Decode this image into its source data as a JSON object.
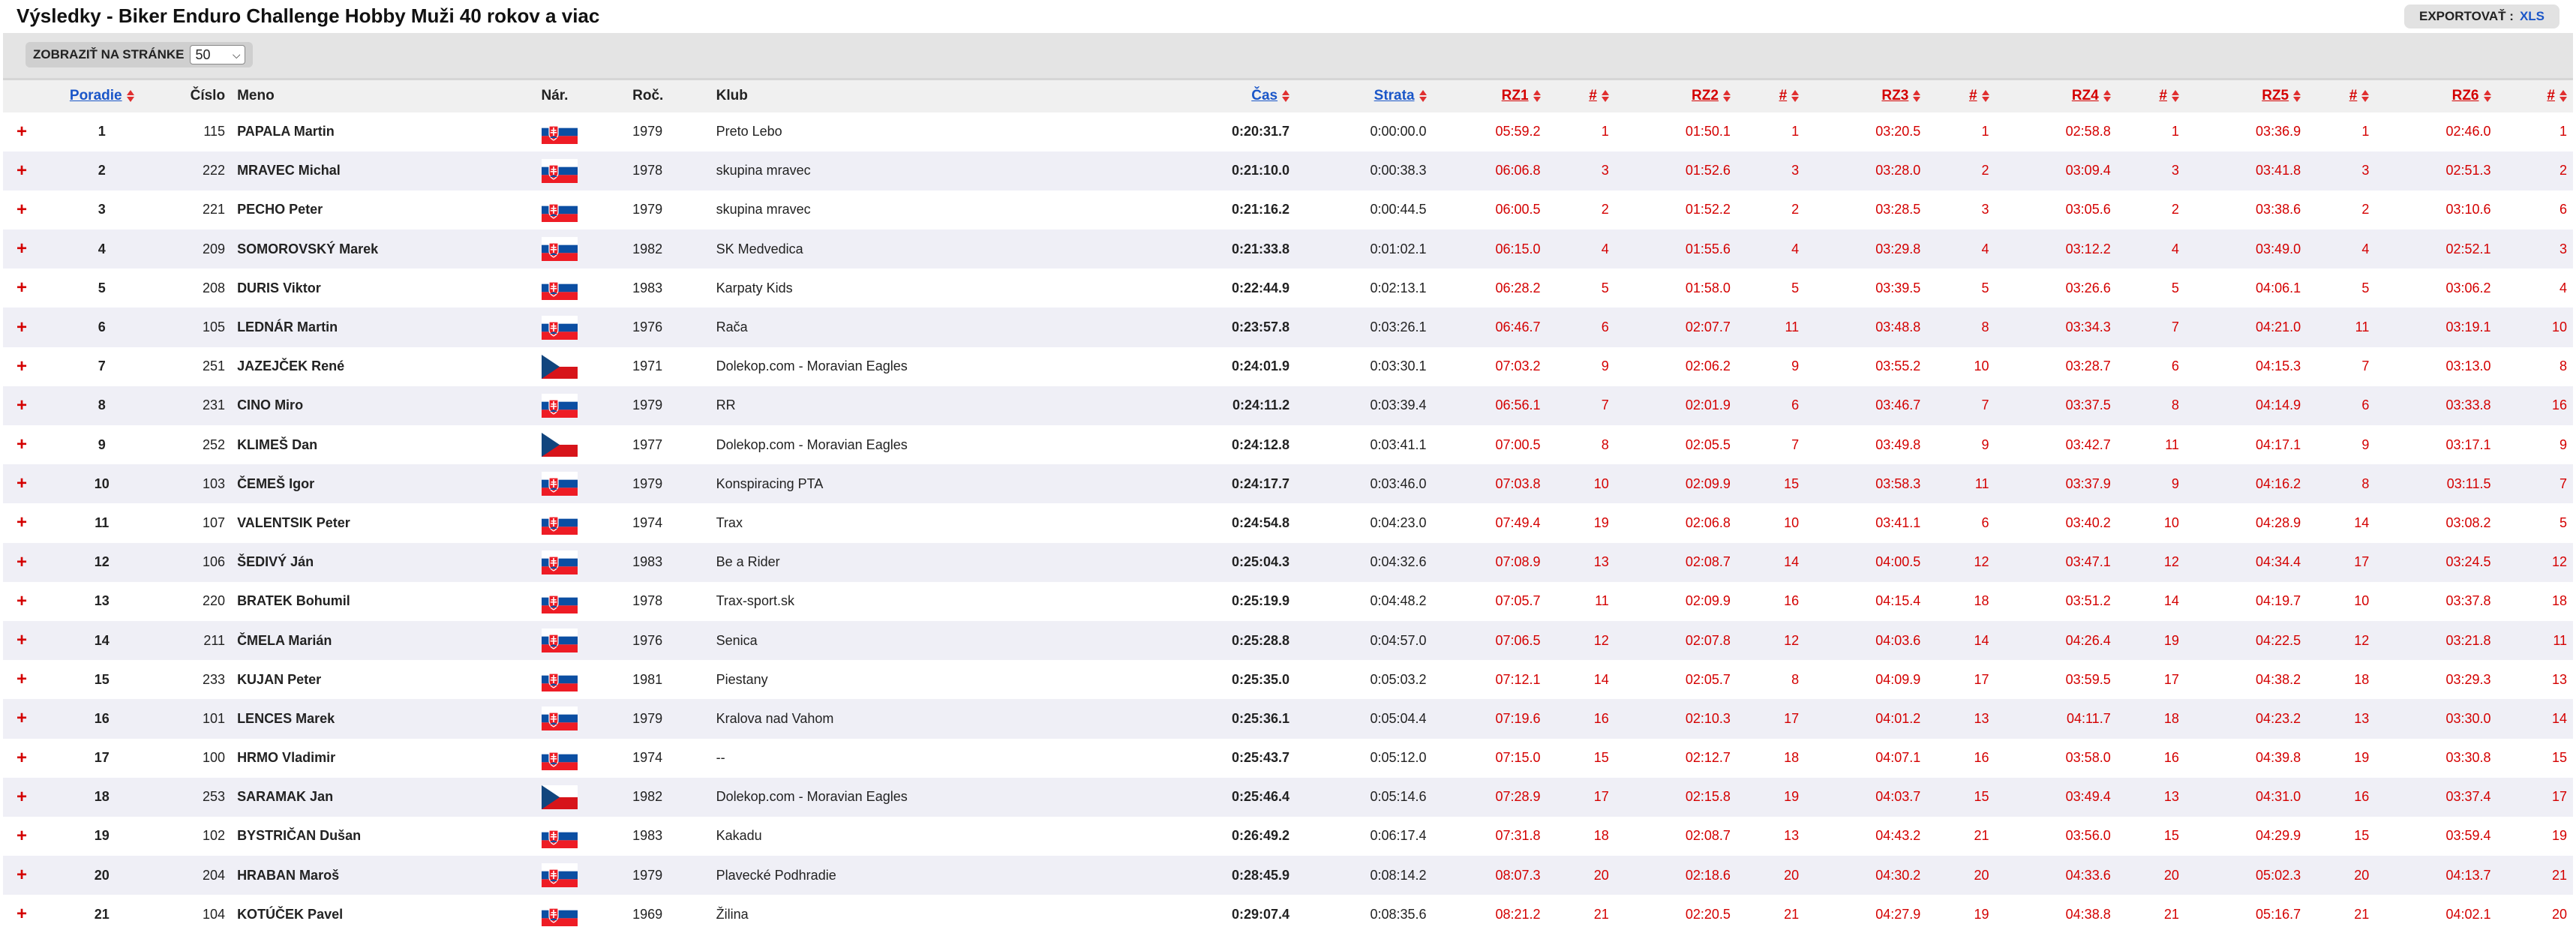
{
  "title": "Výsledky - Biker Enduro Challenge Hobby Muži 40 rokov a viac",
  "export": {
    "label": "EXPORTOVAŤ :",
    "xls": "XLS"
  },
  "perpage": {
    "label": "ZOBRAZIŤ NA STRÁNKE",
    "value": "50"
  },
  "columns": {
    "poradie": "Poradie",
    "cislo": "Číslo",
    "meno": "Meno",
    "nar": "Nár.",
    "roc": "Roč.",
    "klub": "Klub",
    "cas": "Čas",
    "strata": "Strata",
    "rz1": "RZ1",
    "rz2": "RZ2",
    "rz3": "RZ3",
    "rz4": "RZ4",
    "rz5": "RZ5",
    "rz6": "RZ6",
    "hash": "#"
  },
  "colors": {
    "accent_link": "#1a56c8",
    "accent_red": "#d40000",
    "row_alt": "#efeff6"
  },
  "rows": [
    {
      "pos": "1",
      "num": "115",
      "name": "PAPALA Martin",
      "nat": "SVK",
      "year": "1979",
      "club": "Preto Lebo",
      "time": "0:20:31.7",
      "loss": "0:00:00.0",
      "rz": [
        [
          "05:59.2",
          "1"
        ],
        [
          "01:50.1",
          "1"
        ],
        [
          "03:20.5",
          "1"
        ],
        [
          "02:58.8",
          "1"
        ],
        [
          "03:36.9",
          "1"
        ],
        [
          "02:46.0",
          "1"
        ]
      ]
    },
    {
      "pos": "2",
      "num": "222",
      "name": "MRAVEC Michal",
      "nat": "SVK",
      "year": "1978",
      "club": "skupina mravec",
      "time": "0:21:10.0",
      "loss": "0:00:38.3",
      "rz": [
        [
          "06:06.8",
          "3"
        ],
        [
          "01:52.6",
          "3"
        ],
        [
          "03:28.0",
          "2"
        ],
        [
          "03:09.4",
          "3"
        ],
        [
          "03:41.8",
          "3"
        ],
        [
          "02:51.3",
          "2"
        ]
      ]
    },
    {
      "pos": "3",
      "num": "221",
      "name": "PECHO Peter",
      "nat": "SVK",
      "year": "1979",
      "club": "skupina mravec",
      "time": "0:21:16.2",
      "loss": "0:00:44.5",
      "rz": [
        [
          "06:00.5",
          "2"
        ],
        [
          "01:52.2",
          "2"
        ],
        [
          "03:28.5",
          "3"
        ],
        [
          "03:05.6",
          "2"
        ],
        [
          "03:38.6",
          "2"
        ],
        [
          "03:10.6",
          "6"
        ]
      ]
    },
    {
      "pos": "4",
      "num": "209",
      "name": "SOMOROVSKÝ Marek",
      "nat": "SVK",
      "year": "1982",
      "club": "SK Medvedica",
      "time": "0:21:33.8",
      "loss": "0:01:02.1",
      "rz": [
        [
          "06:15.0",
          "4"
        ],
        [
          "01:55.6",
          "4"
        ],
        [
          "03:29.8",
          "4"
        ],
        [
          "03:12.2",
          "4"
        ],
        [
          "03:49.0",
          "4"
        ],
        [
          "02:52.1",
          "3"
        ]
      ]
    },
    {
      "pos": "5",
      "num": "208",
      "name": "DURIS Viktor",
      "nat": "SVK",
      "year": "1983",
      "club": "Karpaty Kids",
      "time": "0:22:44.9",
      "loss": "0:02:13.1",
      "rz": [
        [
          "06:28.2",
          "5"
        ],
        [
          "01:58.0",
          "5"
        ],
        [
          "03:39.5",
          "5"
        ],
        [
          "03:26.6",
          "5"
        ],
        [
          "04:06.1",
          "5"
        ],
        [
          "03:06.2",
          "4"
        ]
      ]
    },
    {
      "pos": "6",
      "num": "105",
      "name": "LEDNÁR Martin",
      "nat": "SVK",
      "year": "1976",
      "club": "Rača",
      "time": "0:23:57.8",
      "loss": "0:03:26.1",
      "rz": [
        [
          "06:46.7",
          "6"
        ],
        [
          "02:07.7",
          "11"
        ],
        [
          "03:48.8",
          "8"
        ],
        [
          "03:34.3",
          "7"
        ],
        [
          "04:21.0",
          "11"
        ],
        [
          "03:19.1",
          "10"
        ]
      ]
    },
    {
      "pos": "7",
      "num": "251",
      "name": "JAZEJČEK René",
      "nat": "CZE",
      "year": "1971",
      "club": "Dolekop.com - Moravian Eagles",
      "time": "0:24:01.9",
      "loss": "0:03:30.1",
      "rz": [
        [
          "07:03.2",
          "9"
        ],
        [
          "02:06.2",
          "9"
        ],
        [
          "03:55.2",
          "10"
        ],
        [
          "03:28.7",
          "6"
        ],
        [
          "04:15.3",
          "7"
        ],
        [
          "03:13.0",
          "8"
        ]
      ]
    },
    {
      "pos": "8",
      "num": "231",
      "name": "CINO Miro",
      "nat": "SVK",
      "year": "1979",
      "club": "RR",
      "time": "0:24:11.2",
      "loss": "0:03:39.4",
      "rz": [
        [
          "06:56.1",
          "7"
        ],
        [
          "02:01.9",
          "6"
        ],
        [
          "03:46.7",
          "7"
        ],
        [
          "03:37.5",
          "8"
        ],
        [
          "04:14.9",
          "6"
        ],
        [
          "03:33.8",
          "16"
        ]
      ]
    },
    {
      "pos": "9",
      "num": "252",
      "name": "KLIMEŠ Dan",
      "nat": "CZE",
      "year": "1977",
      "club": "Dolekop.com - Moravian Eagles",
      "time": "0:24:12.8",
      "loss": "0:03:41.1",
      "rz": [
        [
          "07:00.5",
          "8"
        ],
        [
          "02:05.5",
          "7"
        ],
        [
          "03:49.8",
          "9"
        ],
        [
          "03:42.7",
          "11"
        ],
        [
          "04:17.1",
          "9"
        ],
        [
          "03:17.1",
          "9"
        ]
      ]
    },
    {
      "pos": "10",
      "num": "103",
      "name": "ČEMEŠ Igor",
      "nat": "SVK",
      "year": "1979",
      "club": "Konspiracing PTA",
      "time": "0:24:17.7",
      "loss": "0:03:46.0",
      "rz": [
        [
          "07:03.8",
          "10"
        ],
        [
          "02:09.9",
          "15"
        ],
        [
          "03:58.3",
          "11"
        ],
        [
          "03:37.9",
          "9"
        ],
        [
          "04:16.2",
          "8"
        ],
        [
          "03:11.5",
          "7"
        ]
      ]
    },
    {
      "pos": "11",
      "num": "107",
      "name": "VALENTSIK Peter",
      "nat": "SVK",
      "year": "1974",
      "club": "Trax",
      "time": "0:24:54.8",
      "loss": "0:04:23.0",
      "rz": [
        [
          "07:49.4",
          "19"
        ],
        [
          "02:06.8",
          "10"
        ],
        [
          "03:41.1",
          "6"
        ],
        [
          "03:40.2",
          "10"
        ],
        [
          "04:28.9",
          "14"
        ],
        [
          "03:08.2",
          "5"
        ]
      ]
    },
    {
      "pos": "12",
      "num": "106",
      "name": "ŠEDIVÝ Ján",
      "nat": "SVK",
      "year": "1983",
      "club": "Be a Rider",
      "time": "0:25:04.3",
      "loss": "0:04:32.6",
      "rz": [
        [
          "07:08.9",
          "13"
        ],
        [
          "02:08.7",
          "14"
        ],
        [
          "04:00.5",
          "12"
        ],
        [
          "03:47.1",
          "12"
        ],
        [
          "04:34.4",
          "17"
        ],
        [
          "03:24.5",
          "12"
        ]
      ]
    },
    {
      "pos": "13",
      "num": "220",
      "name": "BRATEK Bohumil",
      "nat": "SVK",
      "year": "1978",
      "club": "Trax-sport.sk",
      "time": "0:25:19.9",
      "loss": "0:04:48.2",
      "rz": [
        [
          "07:05.7",
          "11"
        ],
        [
          "02:09.9",
          "16"
        ],
        [
          "04:15.4",
          "18"
        ],
        [
          "03:51.2",
          "14"
        ],
        [
          "04:19.7",
          "10"
        ],
        [
          "03:37.8",
          "18"
        ]
      ]
    },
    {
      "pos": "14",
      "num": "211",
      "name": "ČMELA Marián",
      "nat": "SVK",
      "year": "1976",
      "club": "Senica",
      "time": "0:25:28.8",
      "loss": "0:04:57.0",
      "rz": [
        [
          "07:06.5",
          "12"
        ],
        [
          "02:07.8",
          "12"
        ],
        [
          "04:03.6",
          "14"
        ],
        [
          "04:26.4",
          "19"
        ],
        [
          "04:22.5",
          "12"
        ],
        [
          "03:21.8",
          "11"
        ]
      ]
    },
    {
      "pos": "15",
      "num": "233",
      "name": "KUJAN Peter",
      "nat": "SVK",
      "year": "1981",
      "club": "Piestany",
      "time": "0:25:35.0",
      "loss": "0:05:03.2",
      "rz": [
        [
          "07:12.1",
          "14"
        ],
        [
          "02:05.7",
          "8"
        ],
        [
          "04:09.9",
          "17"
        ],
        [
          "03:59.5",
          "17"
        ],
        [
          "04:38.2",
          "18"
        ],
        [
          "03:29.3",
          "13"
        ]
      ]
    },
    {
      "pos": "16",
      "num": "101",
      "name": "LENCES Marek",
      "nat": "SVK",
      "year": "1979",
      "club": "Kralova nad Vahom",
      "time": "0:25:36.1",
      "loss": "0:05:04.4",
      "rz": [
        [
          "07:19.6",
          "16"
        ],
        [
          "02:10.3",
          "17"
        ],
        [
          "04:01.2",
          "13"
        ],
        [
          "04:11.7",
          "18"
        ],
        [
          "04:23.2",
          "13"
        ],
        [
          "03:30.0",
          "14"
        ]
      ]
    },
    {
      "pos": "17",
      "num": "100",
      "name": "HRMO Vladimir",
      "nat": "SVK",
      "year": "1974",
      "club": "--",
      "time": "0:25:43.7",
      "loss": "0:05:12.0",
      "rz": [
        [
          "07:15.0",
          "15"
        ],
        [
          "02:12.7",
          "18"
        ],
        [
          "04:07.1",
          "16"
        ],
        [
          "03:58.0",
          "16"
        ],
        [
          "04:39.8",
          "19"
        ],
        [
          "03:30.8",
          "15"
        ]
      ]
    },
    {
      "pos": "18",
      "num": "253",
      "name": "SARAMAK Jan",
      "nat": "CZE",
      "year": "1982",
      "club": "Dolekop.com - Moravian Eagles",
      "time": "0:25:46.4",
      "loss": "0:05:14.6",
      "rz": [
        [
          "07:28.9",
          "17"
        ],
        [
          "02:15.8",
          "19"
        ],
        [
          "04:03.7",
          "15"
        ],
        [
          "03:49.4",
          "13"
        ],
        [
          "04:31.0",
          "16"
        ],
        [
          "03:37.4",
          "17"
        ]
      ]
    },
    {
      "pos": "19",
      "num": "102",
      "name": "BYSTRIČAN Dušan",
      "nat": "SVK",
      "year": "1983",
      "club": "Kakadu",
      "time": "0:26:49.2",
      "loss": "0:06:17.4",
      "rz": [
        [
          "07:31.8",
          "18"
        ],
        [
          "02:08.7",
          "13"
        ],
        [
          "04:43.2",
          "21"
        ],
        [
          "03:56.0",
          "15"
        ],
        [
          "04:29.9",
          "15"
        ],
        [
          "03:59.4",
          "19"
        ]
      ]
    },
    {
      "pos": "20",
      "num": "204",
      "name": "HRABAN Maroš",
      "nat": "SVK",
      "year": "1979",
      "club": "Plavecké Podhradie",
      "time": "0:28:45.9",
      "loss": "0:08:14.2",
      "rz": [
        [
          "08:07.3",
          "20"
        ],
        [
          "02:18.6",
          "20"
        ],
        [
          "04:30.2",
          "20"
        ],
        [
          "04:33.6",
          "20"
        ],
        [
          "05:02.3",
          "20"
        ],
        [
          "04:13.7",
          "21"
        ]
      ]
    },
    {
      "pos": "21",
      "num": "104",
      "name": "KOTÚČEK Pavel",
      "nat": "SVK",
      "year": "1969",
      "club": "Žilina",
      "time": "0:29:07.4",
      "loss": "0:08:35.6",
      "rz": [
        [
          "08:21.2",
          "21"
        ],
        [
          "02:20.5",
          "21"
        ],
        [
          "04:27.9",
          "19"
        ],
        [
          "04:38.8",
          "21"
        ],
        [
          "05:16.7",
          "21"
        ],
        [
          "04:02.1",
          "20"
        ]
      ]
    }
  ]
}
